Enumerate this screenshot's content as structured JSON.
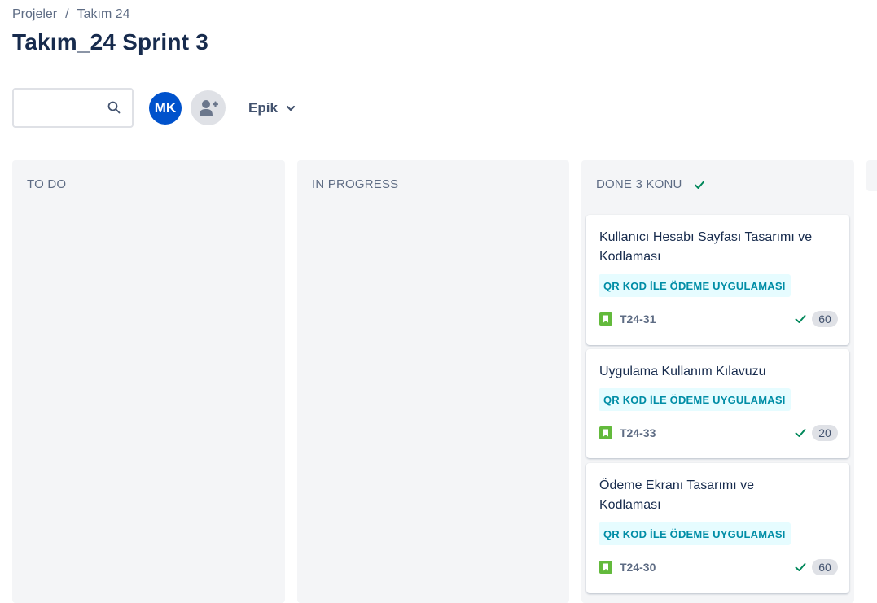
{
  "breadcrumb": {
    "projects": "Projeler",
    "separator": "/",
    "team": "Takım 24"
  },
  "page": {
    "title": "Takım_24 Sprint 3"
  },
  "search": {
    "value": "",
    "placeholder": ""
  },
  "avatar": {
    "initials": "MK",
    "color": "#0052cc"
  },
  "filter": {
    "epic_label": "Epik"
  },
  "columns": {
    "todo": {
      "title": "TO DO"
    },
    "in_progress": {
      "title": "IN PROGRESS"
    },
    "done": {
      "title": "DONE 3 KONU"
    }
  },
  "cards": [
    {
      "title": "Kullanıcı Hesabı Sayfası Tasarımı ve Kodlaması",
      "epic": "QR KOD İLE ÖDEME UYGULAMASI",
      "key": "T24-31",
      "points": "60"
    },
    {
      "title": "Uygulama Kullanım Kılavuzu",
      "epic": "QR KOD İLE ÖDEME UYGULAMASI",
      "key": "T24-33",
      "points": "20"
    },
    {
      "title": "Ödeme Ekranı Tasarımı ve Kodlaması",
      "epic": "QR KOD İLE ÖDEME UYGULAMASI",
      "key": "T24-30",
      "points": "60"
    }
  ],
  "colors": {
    "done_check": "#00875a",
    "story_icon": "#63ba3c",
    "epic_bg": "#e6fcff",
    "epic_text": "#008da6"
  }
}
